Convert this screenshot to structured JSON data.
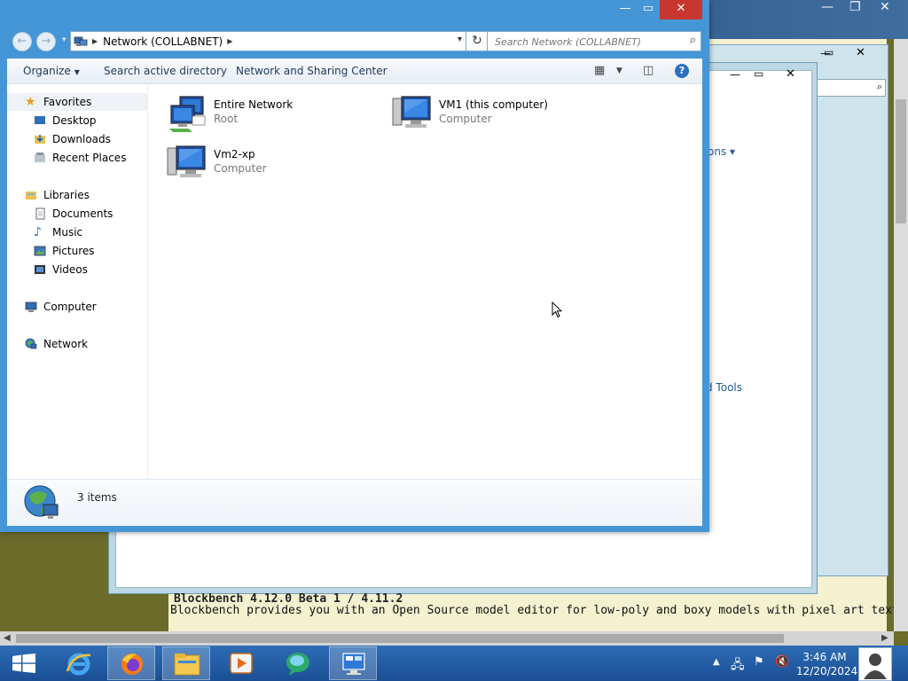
{
  "window": {
    "title": "Network (COLLABNET)",
    "minimize_icon": "minimize-icon",
    "maximize_icon": "maximize-icon",
    "close_icon": "close-icon"
  },
  "address_bar": {
    "path": "Network (COLLABNET)",
    "search_placeholder": "Search Network (COLLABNET)"
  },
  "toolbar": {
    "organize": "Organize",
    "search_ad": "Search active directory",
    "network_sharing": "Network and Sharing Center"
  },
  "sidebar": {
    "favorites": "Favorites",
    "desktop": "Desktop",
    "downloads": "Downloads",
    "recent": "Recent Places",
    "libraries": "Libraries",
    "documents": "Documents",
    "music": "Music",
    "pictures": "Pictures",
    "videos": "Videos",
    "computer": "Computer",
    "network": "Network"
  },
  "items": [
    {
      "name": "Entire Network",
      "type": "Root"
    },
    {
      "name": "VM1 (this computer)",
      "type": "Computer"
    },
    {
      "name": "Vm2-xp",
      "type": "Computer"
    }
  ],
  "status": {
    "count": "3 items"
  },
  "background": {
    "fragment_ons": "ons",
    "fragment_tools": "d Tools",
    "article_text": "Blockbench provides you with an Open Source model editor for low-poly and boxy models with pixel art textures.",
    "article_heading": "Blockbench 4.12.0 Beta 1 / 4.11.2"
  },
  "taskbar": {
    "time": "3:46 AM",
    "date": "12/20/2024"
  },
  "colors": {
    "accent": "#4596d6",
    "close": "#c7372f",
    "taskbar": "#1e5299"
  }
}
